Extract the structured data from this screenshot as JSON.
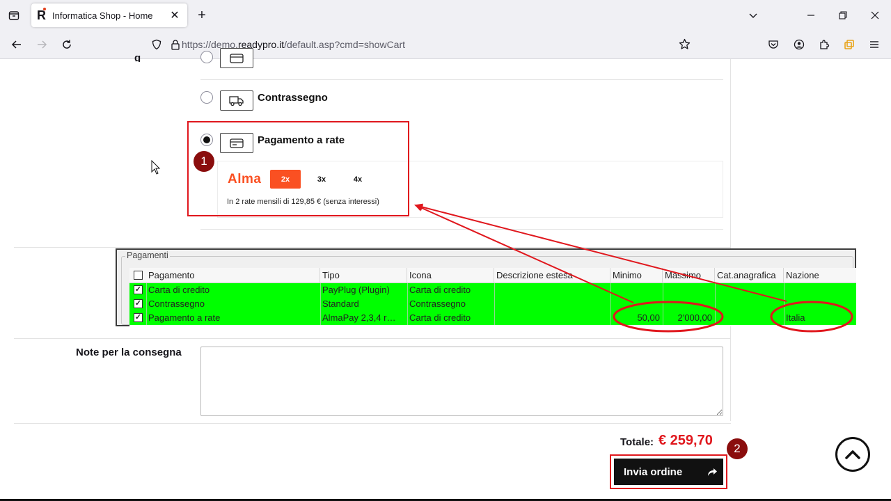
{
  "browser": {
    "tab_title": "Informatica Shop - Home",
    "url_prefix": "https://demo.",
    "url_domain": "readypro.it",
    "url_suffix": "/default.asp?cmd=showCart",
    "favicon_letter": "R"
  },
  "payment": {
    "options": [
      {
        "label": "",
        "selected": false,
        "icon": "card-icon"
      },
      {
        "label": "Contrassegno",
        "selected": false,
        "icon": "truck-icon"
      },
      {
        "label": "Pagamento a rate",
        "selected": true,
        "icon": "card-icon"
      }
    ],
    "alma": {
      "logo": "Alma",
      "installments": [
        "2x",
        "3x",
        "4x"
      ],
      "selected_installment": "2x",
      "description": "In 2 rate mensili di 129,85 € (senza interessi)"
    }
  },
  "table": {
    "group_title": "Pagamenti",
    "headers": [
      "Pagamento",
      "Tipo",
      "Icona",
      "Descrizione estesa",
      "Minimo",
      "Massimo",
      "Cat.anagrafica",
      "Nazione"
    ],
    "rows": [
      {
        "checked": true,
        "cells": [
          "Carta di credito",
          "PayPlug (Plugin)",
          "Carta di credito",
          "",
          "",
          "",
          "",
          ""
        ]
      },
      {
        "checked": true,
        "cells": [
          "Contrassegno",
          "Standard",
          "Contrassegno",
          "",
          "",
          "",
          "",
          ""
        ]
      },
      {
        "checked": true,
        "cells": [
          "Pagamento a rate",
          "AlmaPay 2,3,4 r…",
          "Carta di credito",
          "",
          "50,00",
          "2'000,00",
          "",
          "Italia"
        ]
      }
    ],
    "row_color": "#00ff00"
  },
  "annotations": {
    "step1": "1",
    "step2": "2",
    "color": "#e0171d",
    "badge_color": "#8a0d0d"
  },
  "notes": {
    "label": "Note per la consegna",
    "value": ""
  },
  "order": {
    "total_label": "Totale:",
    "total_value": "€ 259,70",
    "submit_label": "Invia ordine"
  }
}
